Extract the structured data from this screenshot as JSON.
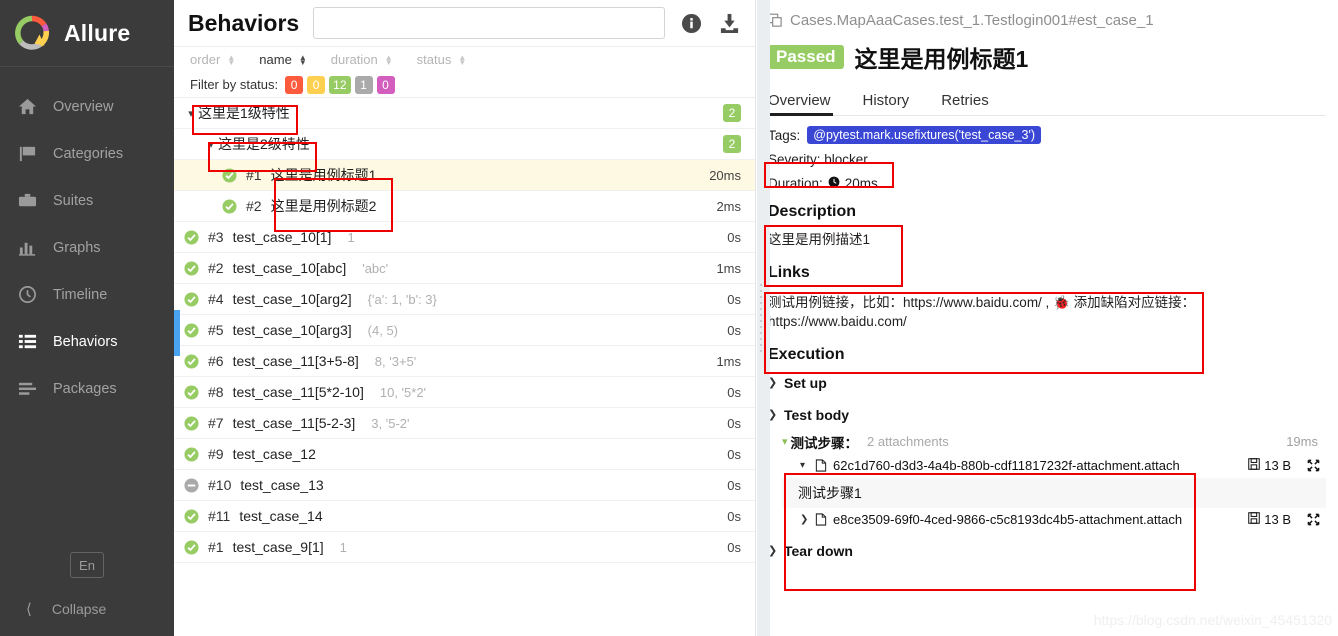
{
  "sidebar": {
    "brand": "Allure",
    "items": [
      {
        "label": "Overview",
        "icon": "home-icon"
      },
      {
        "label": "Categories",
        "icon": "flag-icon"
      },
      {
        "label": "Suites",
        "icon": "briefcase-icon"
      },
      {
        "label": "Graphs",
        "icon": "bar-chart-icon"
      },
      {
        "label": "Timeline",
        "icon": "clock-icon"
      },
      {
        "label": "Behaviors",
        "icon": "list-icon"
      },
      {
        "label": "Packages",
        "icon": "layers-icon"
      }
    ],
    "active_item": "Behaviors",
    "language_button": "En",
    "collapse_label": "Collapse"
  },
  "middle": {
    "title": "Behaviors",
    "search_placeholder": "",
    "search_value": "",
    "info_icon": "info-icon",
    "download_icon": "download-icon",
    "sort": {
      "columns": [
        {
          "label": "order",
          "active": false
        },
        {
          "label": "name",
          "active": true
        },
        {
          "label": "duration",
          "active": false
        },
        {
          "label": "status",
          "active": false
        }
      ]
    },
    "filter": {
      "label": "Filter by status:",
      "chips": [
        {
          "count": "0",
          "color": "#fd5a3e",
          "status": "failed"
        },
        {
          "count": "0",
          "color": "#ffd050",
          "status": "broken"
        },
        {
          "count": "12",
          "color": "#97cc64",
          "status": "passed"
        },
        {
          "count": "1",
          "color": "#aaaaaa",
          "status": "skipped"
        },
        {
          "count": "0",
          "color": "#d35ebe",
          "status": "unknown"
        }
      ]
    },
    "tree": {
      "group1": {
        "name": "这里是1级特性",
        "count": "2"
      },
      "group2": {
        "name": "这里是2级特性",
        "count": "2"
      },
      "cases": [
        {
          "order": "#1",
          "name": "这里是用例标题1",
          "args": "",
          "duration": "20ms",
          "status": "passed",
          "selected": true
        },
        {
          "order": "#2",
          "name": "这里是用例标题2",
          "args": "",
          "duration": "2ms",
          "status": "passed",
          "selected": false
        }
      ]
    },
    "flat_cases": [
      {
        "order": "#3",
        "name": "test_case_10[1]",
        "args": "1",
        "duration": "0s",
        "status": "passed"
      },
      {
        "order": "#2",
        "name": "test_case_10[abc]",
        "args": "'abc'",
        "duration": "1ms",
        "status": "passed"
      },
      {
        "order": "#4",
        "name": "test_case_10[arg2]",
        "args": "{'a': 1, 'b': 3}",
        "duration": "0s",
        "status": "passed"
      },
      {
        "order": "#5",
        "name": "test_case_10[arg3]",
        "args": "(4, 5)",
        "duration": "0s",
        "status": "passed"
      },
      {
        "order": "#6",
        "name": "test_case_11[3+5-8]",
        "args": "8, '3+5'",
        "duration": "1ms",
        "status": "passed"
      },
      {
        "order": "#8",
        "name": "test_case_11[5*2-10]",
        "args": "10, '5*2'",
        "duration": "0s",
        "status": "passed"
      },
      {
        "order": "#7",
        "name": "test_case_11[5-2-3]",
        "args": "3, '5-2'",
        "duration": "0s",
        "status": "passed"
      },
      {
        "order": "#9",
        "name": "test_case_12",
        "args": "",
        "duration": "0s",
        "status": "passed"
      },
      {
        "order": "#10",
        "name": "test_case_13",
        "args": "",
        "duration": "0s",
        "status": "skipped"
      },
      {
        "order": "#11",
        "name": "test_case_14",
        "args": "",
        "duration": "0s",
        "status": "passed"
      },
      {
        "order": "#1",
        "name": "test_case_9[1]",
        "args": "1",
        "duration": "0s",
        "status": "passed"
      }
    ]
  },
  "detail": {
    "breadcrumb": "Cases.MapAaaCases.test_1.Testlogin001#est_case_1",
    "status_badge": "Passed",
    "title": "这里是用例标题1",
    "tabs": [
      {
        "label": "Overview",
        "active": true
      },
      {
        "label": "History",
        "active": false
      },
      {
        "label": "Retries",
        "active": false
      }
    ],
    "tags_label": "Tags:",
    "tag_value": "@pytest.mark.usefixtures('test_case_3')",
    "severity": "Severity: blocker",
    "duration_label": "Duration:",
    "duration_value": "20ms",
    "description_title": "Description",
    "description_text": "这里是用例描述1",
    "links_title": "Links",
    "links_text": "测试用例链接，比如：https://www.baidu.com/ , 🐞 添加缺陷对应链接：https://www.baidu.com/",
    "execution_title": "Execution",
    "setup_label": "Set up",
    "test_body_label": "Test body",
    "teardown_label": "Tear down",
    "step": {
      "name": "测试步骤：",
      "attachments_label": "2 attachments",
      "time": "19ms"
    },
    "attachments": [
      {
        "name": "62c1d760-d3d3-4a4b-880b-cdf11817232f-attachment.attach",
        "size": "13 B",
        "expanded": true,
        "body": "测试步骤1"
      },
      {
        "name": "e8ce3509-69f0-4ced-9866-c5c8193dc4b5-attachment.attach",
        "size": "13 B",
        "expanded": false,
        "body": ""
      }
    ]
  },
  "watermark": "https://blog.csdn.net/weixin_45451320"
}
